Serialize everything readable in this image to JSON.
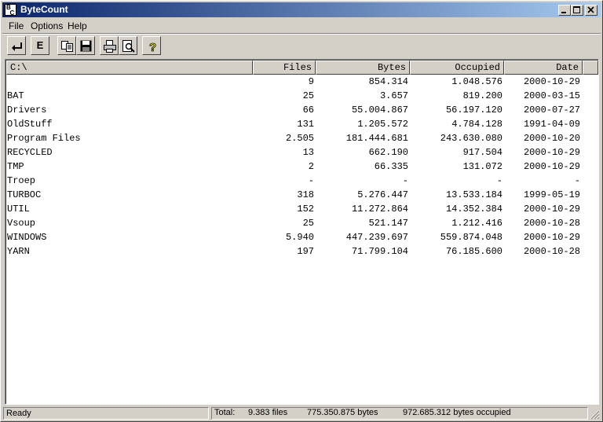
{
  "window": {
    "title": "ByteCount",
    "icon_text_top": "B",
    "icon_text_bottom": "C"
  },
  "menu": [
    {
      "label": "File"
    },
    {
      "label": "Options"
    },
    {
      "label": "Help"
    }
  ],
  "toolbar": {
    "buttons": [
      {
        "icon": "return-arrow-icon"
      },
      {
        "icon": "explore-icon",
        "label": "E"
      },
      {
        "icon": "copy-icon"
      },
      {
        "icon": "save-icon"
      },
      {
        "icon": "print-icon"
      },
      {
        "icon": "print-preview-icon"
      },
      {
        "icon": "help-icon",
        "label": "?"
      }
    ]
  },
  "list": {
    "columns": [
      "C:\\",
      "Files",
      "Bytes",
      "Occupied",
      "Date"
    ],
    "rows": [
      {
        "name": "",
        "files": "9",
        "bytes": "854.314",
        "occupied": "1.048.576",
        "date": "2000-10-29"
      },
      {
        "name": "BAT",
        "files": "25",
        "bytes": "3.657",
        "occupied": "819.200",
        "date": "2000-03-15"
      },
      {
        "name": "Drivers",
        "files": "66",
        "bytes": "55.004.867",
        "occupied": "56.197.120",
        "date": "2000-07-27"
      },
      {
        "name": "OldStuff",
        "files": "131",
        "bytes": "1.205.572",
        "occupied": "4.784.128",
        "date": "1991-04-09"
      },
      {
        "name": "Program Files",
        "files": "2.505",
        "bytes": "181.444.681",
        "occupied": "243.630.080",
        "date": "2000-10-20"
      },
      {
        "name": "RECYCLED",
        "files": "13",
        "bytes": "662.190",
        "occupied": "917.504",
        "date": "2000-10-29"
      },
      {
        "name": "TMP",
        "files": "2",
        "bytes": "66.335",
        "occupied": "131.072",
        "date": "2000-10-29"
      },
      {
        "name": "Troep",
        "files": "-",
        "bytes": "-",
        "occupied": "-",
        "date": "-"
      },
      {
        "name": "TURBOC",
        "files": "318",
        "bytes": "5.276.447",
        "occupied": "13.533.184",
        "date": "1999-05-19"
      },
      {
        "name": "UTIL",
        "files": "152",
        "bytes": "11.272.864",
        "occupied": "14.352.384",
        "date": "2000-10-29"
      },
      {
        "name": "Vsoup",
        "files": "25",
        "bytes": "521.147",
        "occupied": "1.212.416",
        "date": "2000-10-28"
      },
      {
        "name": "WINDOWS",
        "files": "5.940",
        "bytes": "447.239.697",
        "occupied": "559.874.048",
        "date": "2000-10-29"
      },
      {
        "name": "YARN",
        "files": "197",
        "bytes": "71.799.104",
        "occupied": "76.185.600",
        "date": "2000-10-28"
      }
    ]
  },
  "status": {
    "state": "Ready",
    "total_label": "Total:",
    "files": "9.383 files",
    "bytes": "775.350.875 bytes",
    "occupied": "972.685.312 bytes occupied"
  }
}
